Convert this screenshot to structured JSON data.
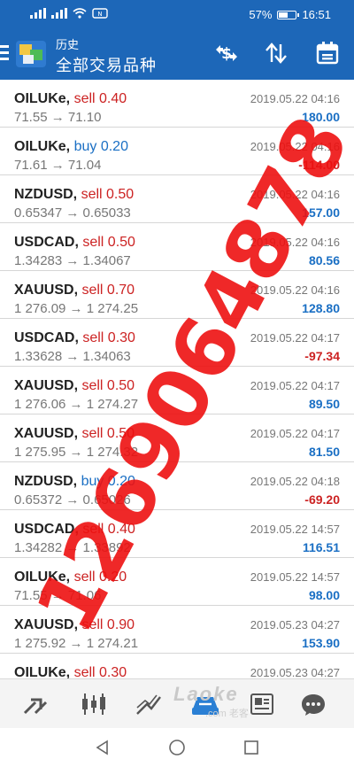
{
  "status_bar": {
    "signal_text": "4G 4G",
    "battery_text": "57%",
    "battery_level": 0.57,
    "time": "16:51"
  },
  "app_bar": {
    "subtitle": "历史",
    "title": "全部交易品种",
    "icons": [
      "menu-icon",
      "mt-logo-icon",
      "currency-exchange-icon",
      "sort-icon",
      "calendar-icon"
    ]
  },
  "trades": [
    {
      "symbol": "OILUKe,",
      "side": "sell",
      "lot": "sell 0.40",
      "prices": "71.55 → 71.10",
      "datetime": "2019.05.22 04:16",
      "profit": "180.00",
      "profit_sign": "pos"
    },
    {
      "symbol": "OILUKe,",
      "side": "buy",
      "lot": "buy 0.20",
      "prices": "71.61 → 71.04",
      "datetime": "2019.05.22 04:16",
      "profit": "-114.00",
      "profit_sign": "neg"
    },
    {
      "symbol": "NZDUSD,",
      "side": "sell",
      "lot": "sell 0.50",
      "prices": "0.65347 → 0.65033",
      "datetime": "2019.05.22 04:16",
      "profit": "157.00",
      "profit_sign": "pos"
    },
    {
      "symbol": "USDCAD,",
      "side": "sell",
      "lot": "sell 0.50",
      "prices": "1.34283 → 1.34067",
      "datetime": "2019.05.22 04:16",
      "profit": "80.56",
      "profit_sign": "pos"
    },
    {
      "symbol": "XAUUSD,",
      "side": "sell",
      "lot": "sell 0.70",
      "prices": "1 276.09 → 1 274.25",
      "datetime": "2019.05.22 04:16",
      "profit": "128.80",
      "profit_sign": "pos"
    },
    {
      "symbol": "USDCAD,",
      "side": "sell",
      "lot": "sell 0.30",
      "prices": "1.33628 → 1.34063",
      "datetime": "2019.05.22 04:17",
      "profit": "-97.34",
      "profit_sign": "neg"
    },
    {
      "symbol": "XAUUSD,",
      "side": "sell",
      "lot": "sell 0.50",
      "prices": "1 276.06 → 1 274.27",
      "datetime": "2019.05.22 04:17",
      "profit": "89.50",
      "profit_sign": "pos"
    },
    {
      "symbol": "XAUUSD,",
      "side": "sell",
      "lot": "sell 0.50",
      "prices": "1 275.95 → 1 274.32",
      "datetime": "2019.05.22 04:17",
      "profit": "81.50",
      "profit_sign": "pos"
    },
    {
      "symbol": "NZDUSD,",
      "side": "buy",
      "lot": "buy 0.20",
      "prices": "0.65372 → 0.65026",
      "datetime": "2019.05.22 04:18",
      "profit": "-69.20",
      "profit_sign": "neg"
    },
    {
      "symbol": "USDCAD,",
      "side": "sell",
      "lot": "sell 0.40",
      "prices": "1.34282 → 1.33892",
      "datetime": "2019.05.22 14:57",
      "profit": "116.51",
      "profit_sign": "pos"
    },
    {
      "symbol": "OILUKe,",
      "side": "sell",
      "lot": "sell 0.20",
      "prices": "71.55 → 71.06",
      "datetime": "2019.05.22 14:57",
      "profit": "98.00",
      "profit_sign": "pos"
    },
    {
      "symbol": "XAUUSD,",
      "side": "sell",
      "lot": "sell 0.90",
      "prices": "1 275.92 → 1 274.21",
      "datetime": "2019.05.23 04:27",
      "profit": "153.90",
      "profit_sign": "pos"
    },
    {
      "symbol": "OILUKe,",
      "side": "sell",
      "lot": "sell 0.30",
      "prices": "",
      "datetime": "2019.05.23 04:27",
      "profit": "",
      "profit_sign": "pos"
    }
  ],
  "watermark": {
    "text": "1269064878"
  },
  "toolbar": {
    "items": [
      "quotes-icon",
      "chart-icon",
      "trade-icon",
      "history-icon",
      "news-icon",
      "chat-icon"
    ],
    "brand": "Laoke",
    "brand_sub": ".com 老客"
  },
  "navbar": {
    "items": [
      "back-icon",
      "home-icon",
      "recents-icon"
    ]
  },
  "colors": {
    "primary": "#1d67b8",
    "sell": "#cc2222",
    "buy": "#1a6fc4",
    "watermark": "#ee1111"
  }
}
